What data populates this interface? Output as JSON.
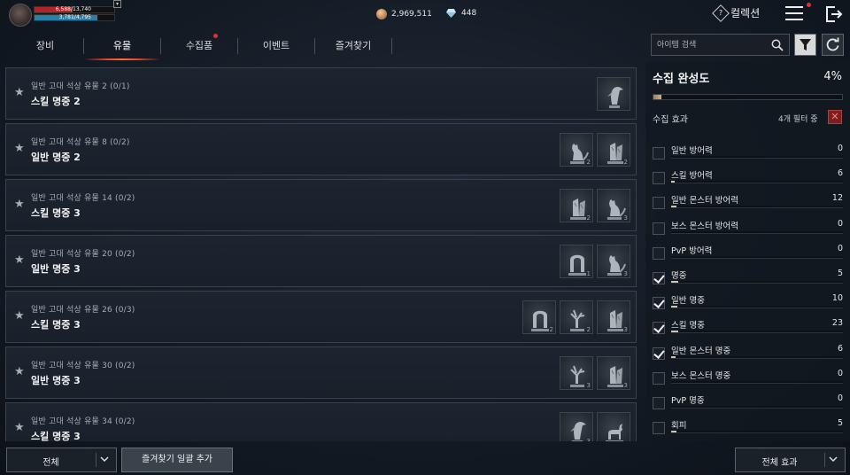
{
  "player": {
    "hp_text": "6,588/13,740",
    "hp_fraction": 0.48,
    "mp_text": "3,781/4,795",
    "mp_fraction": 0.79
  },
  "currency": {
    "gold": "2,969,511",
    "gems": "448"
  },
  "header": {
    "collection_label": "컬렉션"
  },
  "tabs": [
    {
      "label": "장비",
      "active": false,
      "dot": false
    },
    {
      "label": "유물",
      "active": true,
      "dot": false
    },
    {
      "label": "수집품",
      "active": false,
      "dot": true
    },
    {
      "label": "이벤트",
      "active": false,
      "dot": false
    },
    {
      "label": "즐겨찾기",
      "active": false,
      "dot": false
    }
  ],
  "relics": [
    {
      "subtitle": "일반 고대 석상 유물 2 (0/1)",
      "title": "스킬 명중 2",
      "items": [
        {
          "icon": "crow-statue-icon",
          "count": ""
        }
      ]
    },
    {
      "subtitle": "일반 고대 석상 유물 8 (0/2)",
      "title": "일반 명중 2",
      "items": [
        {
          "icon": "wolf-statue-icon",
          "count": "2"
        },
        {
          "icon": "stele-statue-icon",
          "count": "2"
        }
      ]
    },
    {
      "subtitle": "일반 고대 석상 유물 14 (0/2)",
      "title": "스킬 명중 3",
      "items": [
        {
          "icon": "stele-statue-icon",
          "count": "2"
        },
        {
          "icon": "wolf-statue-icon",
          "count": "3"
        }
      ]
    },
    {
      "subtitle": "일반 고대 석상 유물 20 (0/2)",
      "title": "일반 명중 3",
      "items": [
        {
          "icon": "arch-statue-icon",
          "count": "1"
        },
        {
          "icon": "wolf-statue-icon",
          "count": "3"
        }
      ]
    },
    {
      "subtitle": "일반 고대 석상 유물 26 (0/3)",
      "title": "스킬 명중 3",
      "items": [
        {
          "icon": "arch-statue-icon",
          "count": "2"
        },
        {
          "icon": "tree-statue-icon",
          "count": "2"
        },
        {
          "icon": "stele-statue-icon",
          "count": "3"
        }
      ]
    },
    {
      "subtitle": "일반 고대 석상 유물 30 (0/2)",
      "title": "일반 명중 3",
      "items": [
        {
          "icon": "tree-statue-icon",
          "count": "3"
        },
        {
          "icon": "stele-statue-icon",
          "count": "3"
        }
      ]
    },
    {
      "subtitle": "일반 고대 석상 유물 34 (0/2)",
      "title": "스킬 명중 3",
      "items": [
        {
          "icon": "crow-statue-icon",
          "count": "3"
        },
        {
          "icon": "goat-statue-icon",
          "count": ""
        }
      ]
    }
  ],
  "search": {
    "placeholder": "아이템 검색"
  },
  "completion": {
    "title": "수집 완성도",
    "percent_text": "4%",
    "fraction": 0.04
  },
  "effects": {
    "title": "수집 효과",
    "filter_count": "4개 필터 중",
    "stats": [
      {
        "name": "일반 방어력",
        "value": "0",
        "checked": false,
        "fraction": 0.0
      },
      {
        "name": "스킬 방어력",
        "value": "6",
        "checked": false,
        "fraction": 0.015
      },
      {
        "name": "일반 몬스터 방어력",
        "value": "12",
        "checked": false,
        "fraction": 0.03
      },
      {
        "name": "보스 몬스터 방어력",
        "value": "0",
        "checked": false,
        "fraction": 0.0
      },
      {
        "name": "PvP 방어력",
        "value": "0",
        "checked": false,
        "fraction": 0.0
      },
      {
        "name": "명중",
        "value": "5",
        "checked": true,
        "fraction": 0.04
      },
      {
        "name": "일반 명중",
        "value": "10",
        "checked": true,
        "fraction": 0.035
      },
      {
        "name": "스킬 명중",
        "value": "23",
        "checked": true,
        "fraction": 0.04
      },
      {
        "name": "일반 몬스터 명중",
        "value": "6",
        "checked": true,
        "fraction": 0.025
      },
      {
        "name": "보스 몬스터 명중",
        "value": "0",
        "checked": false,
        "fraction": 0.0
      },
      {
        "name": "PvP 명중",
        "value": "0",
        "checked": false,
        "fraction": 0.0
      },
      {
        "name": "회피",
        "value": "5",
        "checked": false,
        "fraction": 0.03
      }
    ]
  },
  "bottom": {
    "filter_dropdown": "전체",
    "batch_favorite": "즐겨찾기 일괄 추가",
    "effect_dropdown": "전체 효과"
  },
  "colors": {
    "accent": "#e04a2a",
    "hp": "#b02525",
    "mp": "#2a7fa8"
  }
}
